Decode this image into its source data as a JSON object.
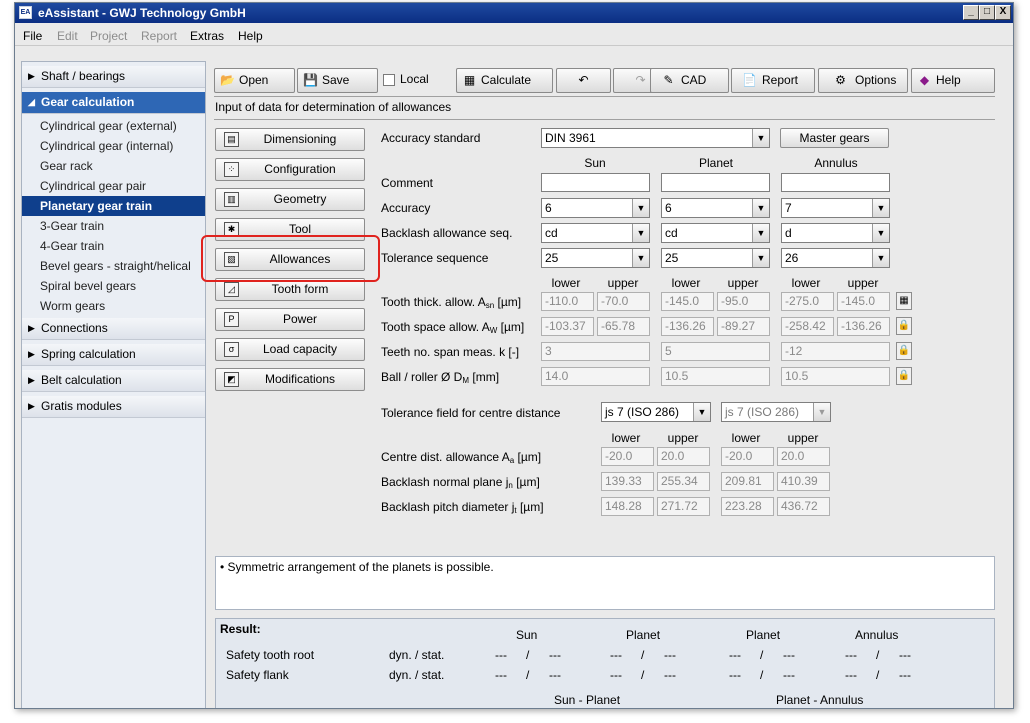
{
  "window": {
    "icon_text": "EA",
    "title": "eAssistant - GWJ Technology GmbH",
    "buttons": [
      "_",
      "□",
      "X"
    ]
  },
  "menubar": [
    "File",
    "Edit",
    "Project",
    "Report",
    "Extras",
    "Help"
  ],
  "sidebar": {
    "groups": [
      {
        "label": "Shaft / bearings",
        "open": false
      },
      {
        "label": "Gear calculation",
        "open": true
      },
      {
        "label": "Connections",
        "open": false
      },
      {
        "label": "Spring calculation",
        "open": false
      },
      {
        "label": "Belt calculation",
        "open": false
      },
      {
        "label": "Gratis modules",
        "open": false
      }
    ],
    "items": [
      "Cylindrical gear (external)",
      "Cylindrical gear (internal)",
      "Gear rack",
      "Cylindrical gear pair",
      "Planetary gear train",
      "3-Gear train",
      "4-Gear train",
      "Bevel gears - straight/helical",
      "Spiral bevel gears",
      "Worm gears"
    ],
    "selected_item": "Planetary gear train"
  },
  "toolbar": {
    "open": "Open",
    "save": "Save",
    "local": "Local",
    "calculate": "Calculate",
    "undo": "↶",
    "redo": "↷",
    "cad": "CAD",
    "report": "Report",
    "options": "Options",
    "help": "Help"
  },
  "section_title": "Input of data for determination of allowances",
  "nav": [
    "Dimensioning",
    "Configuration",
    "Geometry",
    "Tool",
    "Allowances",
    "Tooth form",
    "Power",
    "Load capacity",
    "Modifications"
  ],
  "nav_selected": "Allowances",
  "form": {
    "accuracy_standard_label": "Accuracy standard",
    "accuracy_standard_value": "DIN 3961",
    "master_gears_button": "Master gears",
    "col_sun": "Sun",
    "col_planet": "Planet",
    "col_annulus": "Annulus",
    "comment_label": "Comment",
    "accuracy_label": "Accuracy",
    "accuracy": [
      "6",
      "6",
      "7"
    ],
    "backlash_seq_label": "Backlash allowance seq.",
    "backlash_seq": [
      "cd",
      "cd",
      "d"
    ],
    "tolerance_seq_label": "Tolerance sequence",
    "tolerance_seq": [
      "25",
      "25",
      "26"
    ],
    "lower": "lower",
    "upper": "upper",
    "tooth_thick_label": "Tooth thick. allow. A",
    "tooth_thick_sub": "sn",
    "tooth_thick_unit": " [µm]",
    "tooth_thick": [
      "-110.0",
      "-70.0",
      "-145.0",
      "-95.0",
      "-275.0",
      "-145.0"
    ],
    "tooth_space_label": "Tooth space allow. A",
    "tooth_space_sub": "W",
    "tooth_space_unit": " [µm]",
    "tooth_space": [
      "-103.37",
      "-65.78",
      "-136.26",
      "-89.27",
      "-258.42",
      "-136.26"
    ],
    "teeth_span_label": "Teeth no. span meas. k [-]",
    "teeth_span": [
      "3",
      "5",
      "-12"
    ],
    "ball_label": "Ball / roller Ø D",
    "ball_sub": "M",
    "ball_unit": " [mm]",
    "ball": [
      "14.0",
      "10.5",
      "10.5"
    ],
    "tol_field_label": "Tolerance field for centre distance",
    "tol_field": [
      "js 7 (ISO 286)",
      "js 7 (ISO 286)"
    ],
    "centre_dist_label": "Centre dist. allowance A",
    "centre_dist_sub": "a",
    "centre_dist_unit": " [µm]",
    "centre_dist": [
      "-20.0",
      "20.0",
      "-20.0",
      "20.0"
    ],
    "backlash_normal_label": "Backlash normal plane j",
    "backlash_normal_sub": "n",
    "backlash_normal_unit": " [µm]",
    "backlash_normal": [
      "139.33",
      "255.34",
      "209.81",
      "410.39"
    ],
    "backlash_pitch_label": "Backlash pitch diameter j",
    "backlash_pitch_sub": "t",
    "backlash_pitch_unit": " [µm]",
    "backlash_pitch": [
      "148.28",
      "271.72",
      "223.28",
      "436.72"
    ]
  },
  "info_message": "• Symmetric arrangement of the planets is possible.",
  "result": {
    "title": "Result:",
    "cols": [
      "Sun",
      "Planet",
      "Planet",
      "Annulus"
    ],
    "rows": [
      {
        "label": "Safety tooth root",
        "type": "dyn. / stat.",
        "cells": [
          "---",
          "/",
          "---",
          "---",
          "/",
          "---",
          "---",
          "/",
          "---",
          "---",
          "/",
          "---"
        ]
      },
      {
        "label": "Safety flank",
        "type": "dyn. / stat.",
        "cells": [
          "---",
          "/",
          "---",
          "---",
          "/",
          "---",
          "---",
          "/",
          "---",
          "---",
          "/",
          "---"
        ]
      }
    ],
    "pairs": [
      "Sun - Planet",
      "Planet - Annulus"
    ]
  },
  "colors": {
    "titlebar": "#0b2e83",
    "sidebar_open_group": "#2e67b5",
    "sidebar_selected": "#0f3f8c",
    "highlight": "#e0231e"
  }
}
